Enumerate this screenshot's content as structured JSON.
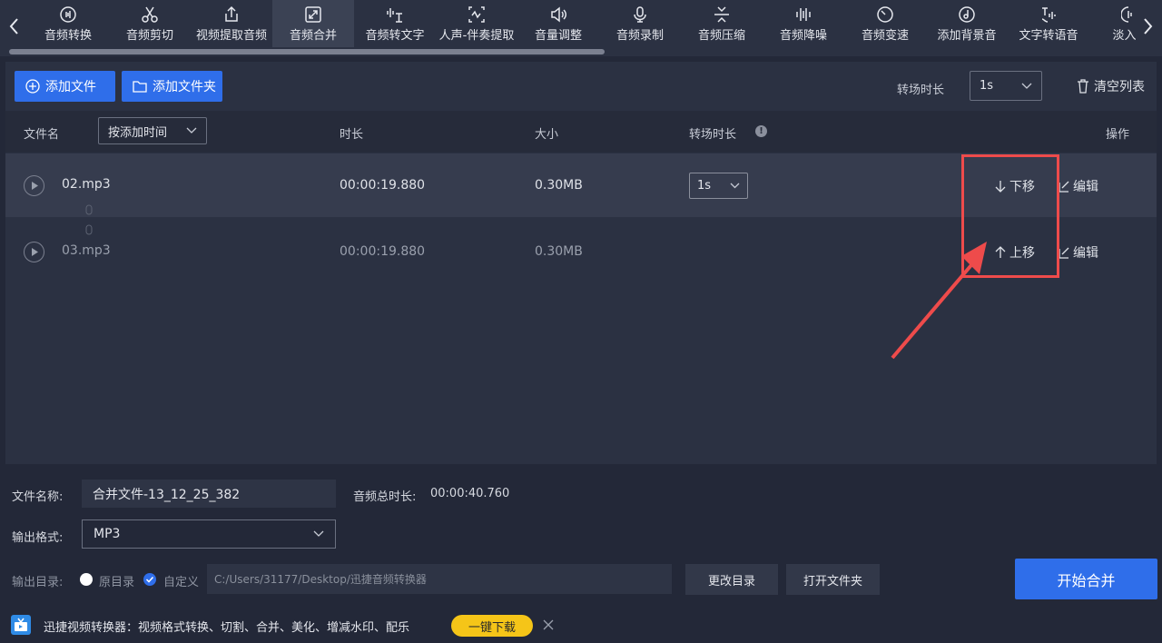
{
  "toolbar": {
    "tools": [
      {
        "label": "音频转换",
        "icon": "audio-convert-icon"
      },
      {
        "label": "音频剪切",
        "icon": "scissors-icon"
      },
      {
        "label": "视频提取音频",
        "icon": "upload-box-icon"
      },
      {
        "label": "音频合并",
        "icon": "merge-icon",
        "active": true
      },
      {
        "label": "音频转文字",
        "icon": "wave-text-icon"
      },
      {
        "label": "人声-伴奏提取",
        "icon": "voice-extract-icon"
      },
      {
        "label": "音量调整",
        "icon": "volume-icon"
      },
      {
        "label": "音频录制",
        "icon": "microphone-icon"
      },
      {
        "label": "音频压缩",
        "icon": "compress-icon"
      },
      {
        "label": "音频降噪",
        "icon": "denoise-icon"
      },
      {
        "label": "音频变速",
        "icon": "speed-icon"
      },
      {
        "label": "添加背景音",
        "icon": "music-disc-icon"
      },
      {
        "label": "文字转语音",
        "icon": "tts-icon"
      },
      {
        "label": "淡入淡",
        "icon": "fade-icon"
      }
    ]
  },
  "actions": {
    "add_file": "添加文件",
    "add_folder": "添加文件夹",
    "transition_label": "转场时长",
    "transition_value": "1s",
    "clear_list": "清空列表"
  },
  "table": {
    "headers": {
      "filename": "文件名",
      "sort": "按添加时间",
      "duration": "时长",
      "size": "大小",
      "transition": "转场时长",
      "operation": "操作"
    },
    "info_mark": "!",
    "rows": [
      {
        "name": "02.mp3",
        "duration": "00:00:19.880",
        "size": "0.30MB",
        "transition": "1s",
        "move": "下移",
        "edit": "编辑"
      },
      {
        "name": "03.mp3",
        "duration": "00:00:19.880",
        "size": "0.30MB",
        "transition": "",
        "move": "上移",
        "edit": "编辑"
      }
    ]
  },
  "output": {
    "filename_label": "文件名称:",
    "filename_value": "合并文件-13_12_25_382",
    "total_label": "音频总时长:",
    "total_value": "00:00:40.760",
    "format_label": "输出格式:",
    "format_value": "MP3",
    "dir_label": "输出目录:",
    "dir_original": "原目录",
    "dir_custom": "自定义",
    "dir_path": "C:/Users/31177/Desktop/迅捷音频转换器",
    "change_dir": "更改目录",
    "open_folder": "打开文件夹",
    "start": "开始合并"
  },
  "ad": {
    "text": "迅捷视频转换器：视频格式转换、切割、合并、美化、增减水印、配乐",
    "button": "一键下载"
  },
  "colors": {
    "accent": "#2f6eea",
    "highlight": "#ee4b4b",
    "ad_button": "#f5c518"
  }
}
